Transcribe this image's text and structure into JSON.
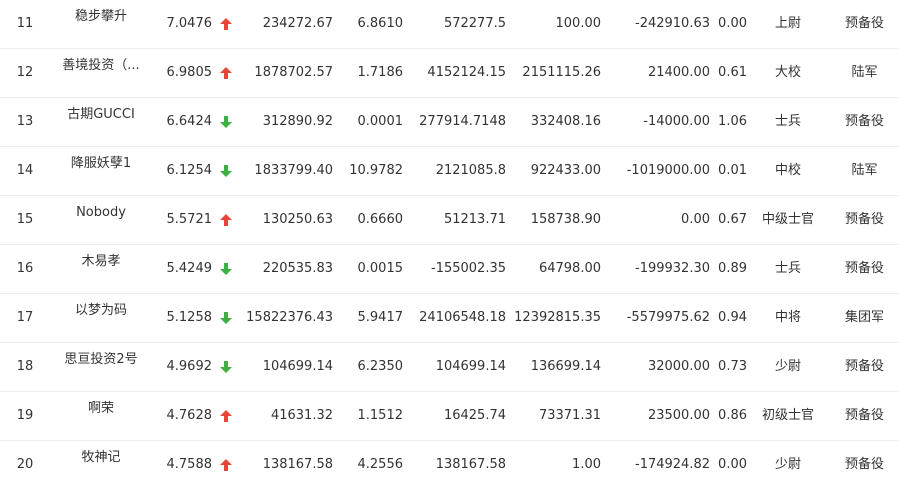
{
  "colors": {
    "up": "#e8443a",
    "down": "#3cb043",
    "divider": "#ececec",
    "text": "#333333"
  },
  "rows": [
    {
      "rank": "11",
      "name": "稳步攀升",
      "score": "7.0476",
      "trend": "up",
      "c5": "234272.67",
      "c6": "6.8610",
      "c7": "572277.5",
      "c8": "100.00",
      "c9": "-242910.63",
      "c10": "0.00",
      "title": "上尉",
      "corps": "预备役"
    },
    {
      "rank": "12",
      "name": "善境投资（...",
      "score": "6.9805",
      "trend": "up",
      "c5": "1878702.57",
      "c6": "1.7186",
      "c7": "4152124.15",
      "c8": "2151115.26",
      "c9": "21400.00",
      "c10": "0.61",
      "title": "大校",
      "corps": "陆军"
    },
    {
      "rank": "13",
      "name": "古期GUCCI",
      "score": "6.6424",
      "trend": "down",
      "c5": "312890.92",
      "c6": "0.0001",
      "c7": "277914.7148",
      "c8": "332408.16",
      "c9": "-14000.00",
      "c10": "1.06",
      "title": "士兵",
      "corps": "预备役"
    },
    {
      "rank": "14",
      "name": "降服妖孽1",
      "score": "6.1254",
      "trend": "down",
      "c5": "1833799.40",
      "c6": "10.9782",
      "c7": "2121085.8",
      "c8": "922433.00",
      "c9": "-1019000.00",
      "c10": "0.01",
      "title": "中校",
      "corps": "陆军"
    },
    {
      "rank": "15",
      "name": "Nobody",
      "score": "5.5721",
      "trend": "up",
      "c5": "130250.63",
      "c6": "0.6660",
      "c7": "51213.71",
      "c8": "158738.90",
      "c9": "0.00",
      "c10": "0.67",
      "title": "中级士官",
      "corps": "预备役"
    },
    {
      "rank": "16",
      "name": "木易孝",
      "score": "5.4249",
      "trend": "down",
      "c5": "220535.83",
      "c6": "0.0015",
      "c7": "-155002.35",
      "c8": "64798.00",
      "c9": "-199932.30",
      "c10": "0.89",
      "title": "士兵",
      "corps": "预备役"
    },
    {
      "rank": "17",
      "name": "以梦为码",
      "score": "5.1258",
      "trend": "down",
      "c5": "15822376.43",
      "c6": "5.9417",
      "c7": "24106548.18",
      "c8": "12392815.35",
      "c9": "-5579975.62",
      "c10": "0.94",
      "title": "中将",
      "corps": "集团军"
    },
    {
      "rank": "18",
      "name": "思亘投资2号",
      "score": "4.9692",
      "trend": "down",
      "c5": "104699.14",
      "c6": "6.2350",
      "c7": "104699.14",
      "c8": "136699.14",
      "c9": "32000.00",
      "c10": "0.73",
      "title": "少尉",
      "corps": "预备役"
    },
    {
      "rank": "19",
      "name": "啊荣",
      "score": "4.7628",
      "trend": "up",
      "c5": "41631.32",
      "c6": "1.1512",
      "c7": "16425.74",
      "c8": "73371.31",
      "c9": "23500.00",
      "c10": "0.86",
      "title": "初级士官",
      "corps": "预备役"
    },
    {
      "rank": "20",
      "name": "牧神记",
      "score": "4.7588",
      "trend": "up",
      "c5": "138167.58",
      "c6": "4.2556",
      "c7": "138167.58",
      "c8": "1.00",
      "c9": "-174924.82",
      "c10": "0.00",
      "title": "少尉",
      "corps": "预备役"
    }
  ]
}
